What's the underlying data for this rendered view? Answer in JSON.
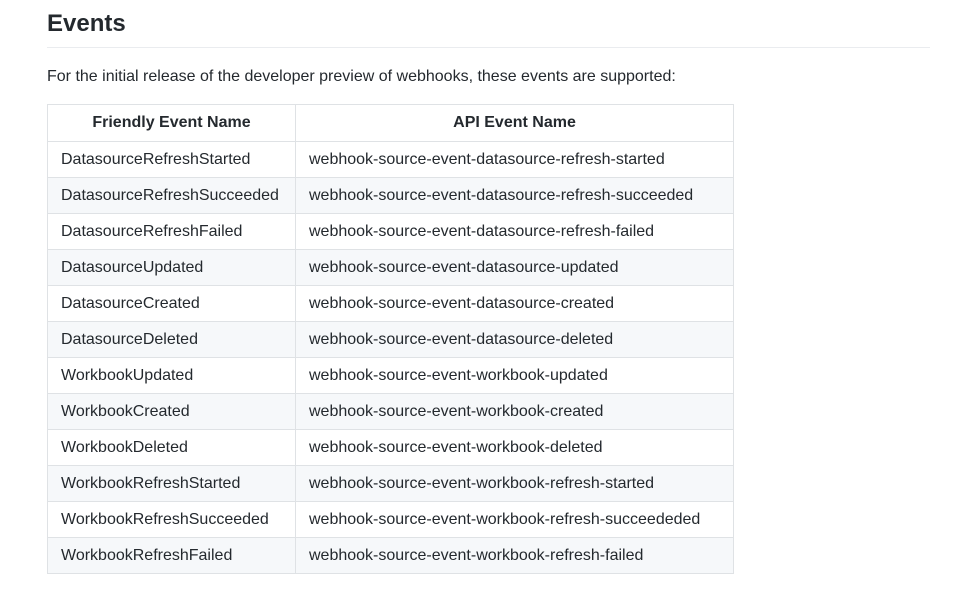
{
  "section": {
    "title": "Events",
    "intro": "For the initial release of the developer preview of webhooks, these events are supported:"
  },
  "table": {
    "headers": [
      "Friendly Event Name",
      "API Event Name"
    ],
    "rows": [
      [
        "DatasourceRefreshStarted",
        "webhook-source-event-datasource-refresh-started"
      ],
      [
        "DatasourceRefreshSucceeded",
        "webhook-source-event-datasource-refresh-succeeded"
      ],
      [
        "DatasourceRefreshFailed",
        "webhook-source-event-datasource-refresh-failed"
      ],
      [
        "DatasourceUpdated",
        "webhook-source-event-datasource-updated"
      ],
      [
        "DatasourceCreated",
        "webhook-source-event-datasource-created"
      ],
      [
        "DatasourceDeleted",
        "webhook-source-event-datasource-deleted"
      ],
      [
        "WorkbookUpdated",
        "webhook-source-event-workbook-updated"
      ],
      [
        "WorkbookCreated",
        "webhook-source-event-workbook-created"
      ],
      [
        "WorkbookDeleted",
        "webhook-source-event-workbook-deleted"
      ],
      [
        "WorkbookRefreshStarted",
        "webhook-source-event-workbook-refresh-started"
      ],
      [
        "WorkbookRefreshSucceeded",
        "webhook-source-event-workbook-refresh-succeededed"
      ],
      [
        "WorkbookRefreshFailed",
        "webhook-source-event-workbook-refresh-failed"
      ]
    ]
  }
}
